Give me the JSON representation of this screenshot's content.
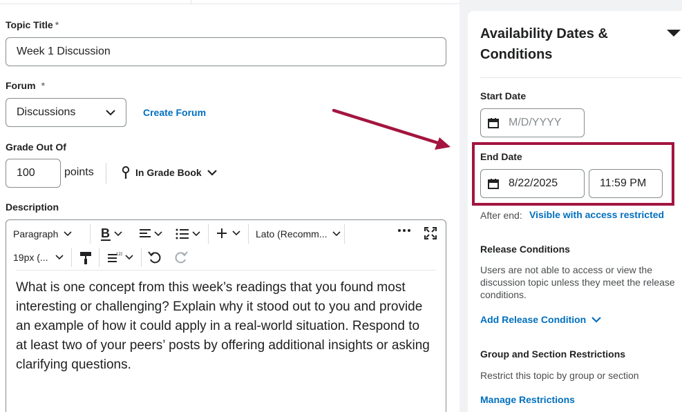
{
  "form": {
    "topic_title_label": "Topic Title",
    "required_mark": "*",
    "topic_title_value": "Week 1 Discussion",
    "forum_label": "Forum",
    "forum_value": "Discussions",
    "create_forum_link": "Create Forum",
    "grade_label": "Grade Out Of",
    "grade_value": "100",
    "points_label": "points",
    "gradebook_label": "In Grade Book",
    "description_label": "Description"
  },
  "toolbar": {
    "paragraph": "Paragraph",
    "font_family": "Lato (Recomm...",
    "font_size": "19px (..."
  },
  "editor": {
    "content": "What is one concept from this week’s readings that you found most interesting or challenging? Explain why it stood out to you and provide an example of how it could apply in a real-world situation. Respond to at least two of your peers’ posts by offering additional insights or asking clarifying questions."
  },
  "panel": {
    "title": "Availability Dates & Conditions",
    "start_date_label": "Start Date",
    "start_date_placeholder": "M/D/YYYY",
    "end_date_label": "End Date",
    "end_date_value": "8/22/2025",
    "end_time_value": "11:59 PM",
    "after_end_label": "After end:",
    "after_end_value": "Visible with access restricted",
    "release_conditions_label": "Release Conditions",
    "release_conditions_text": "Users are not able to access or view the discussion topic unless they meet the release conditions.",
    "add_release_condition": "Add Release Condition",
    "group_section_label": "Group and Section Restrictions",
    "group_section_text": "Restrict this topic by group or section",
    "manage_restrictions": "Manage Restrictions"
  },
  "colors": {
    "accent_link": "#006fbf",
    "annotation": "#a3153f",
    "panel_bg": "#f1f2f4"
  }
}
